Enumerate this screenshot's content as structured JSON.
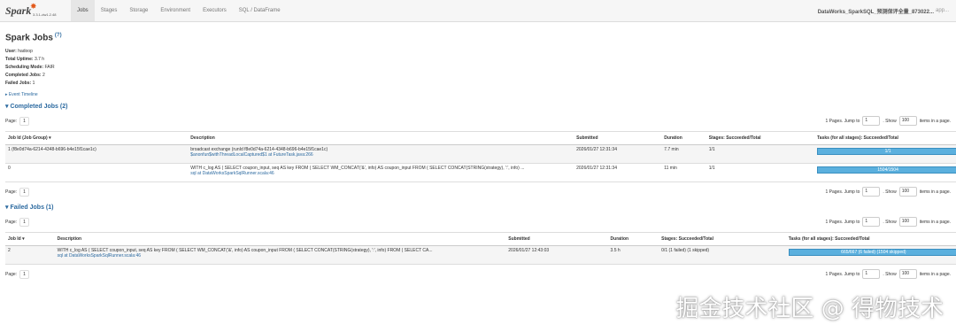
{
  "nav": {
    "logo_text": "Spark",
    "version": "3.3.1-dw1.2.48",
    "tabs": [
      "Jobs",
      "Stages",
      "Storage",
      "Environment",
      "Executors",
      "SQL / DataFrame"
    ],
    "app_name": "DataWorks_SparkSQL_预测保评全量_873022...",
    "app_suffix": "app..."
  },
  "page": {
    "title": "Spark Jobs",
    "help": "(?)",
    "user_label": "User:",
    "user": "hadoop",
    "uptime_label": "Total Uptime:",
    "uptime": "3.7 h",
    "mode_label": "Scheduling Mode:",
    "mode": "FAIR",
    "completed_label": "Completed Jobs:",
    "completed": "2",
    "failed_label": "Failed Jobs:",
    "failed": "1",
    "timeline": "▸ Event Timeline"
  },
  "pager": {
    "page_label": "Page:",
    "page_num": "1",
    "pages_text": "1 Pages. Jump to",
    "jump_value": "1",
    "show_label": ". Show",
    "show_value": "100",
    "items_text": "items in a page."
  },
  "completed": {
    "title": "Completed Jobs (2)",
    "headers": [
      "Job Id (Job Group) ▾",
      "Description",
      "Submitted",
      "Duration",
      "Stages: Succeeded/Total",
      "Tasks (for all stages): Succeeded/Total"
    ],
    "rows": [
      {
        "id": "1 (f8e0d74a-6214-4348-b696-b4e15f1cae1c)",
        "desc": "broadcast exchange (runId f8e0d74a-6214-4348-b696-b4e15f1cae1c)",
        "link": "$anonfun$withThreadLocalCaptured$1 at FutureTask.java:266",
        "submitted": "2026/01/27 12:31:34",
        "duration": "7.7 min",
        "stages": "1/1",
        "tasks": "1/1",
        "progress": 1.0
      },
      {
        "id": "0",
        "desc": "WITH c_log AS ( SELECT coupon_input, seq AS key FROM ( SELECT WM_CONCAT('&', info) AS coupon_input FROM ( SELECT CONCAT(STRING(strategy), ':', info) ...",
        "link": "sql at DataWorksSparkSqlRunner.scala:46",
        "submitted": "2026/01/27 12:31:34",
        "duration": "11 min",
        "stages": "1/1",
        "tasks": "1504/1504",
        "progress": 1.0
      }
    ]
  },
  "failed": {
    "title": "Failed Jobs (1)",
    "headers": [
      "Job Id ▾",
      "Description",
      "Submitted",
      "Duration",
      "Stages: Succeeded/Total",
      "Tasks (for all stages): Succeeded/Total"
    ],
    "rows": [
      {
        "id": "2",
        "desc": "WITH c_log AS ( SELECT coupon_input, seq AS key FROM ( SELECT WM_CONCAT('&', info) AS coupon_input FROM ( SELECT CONCAT(STRING(strategy), ':', info) FROM ( SELECT CA...",
        "link": "sql at DataWorksSparkSqlRunner.scala:46",
        "submitted": "2026/01/27 12:43:03",
        "duration": "3.5 h",
        "stages": "0/1 (1 failed) (1 skipped)",
        "tasks": "665/667 (6 failed) (1504 skipped)",
        "progress": 0.997
      }
    ]
  },
  "watermark": "掘金技术社区 @ 得物技术"
}
